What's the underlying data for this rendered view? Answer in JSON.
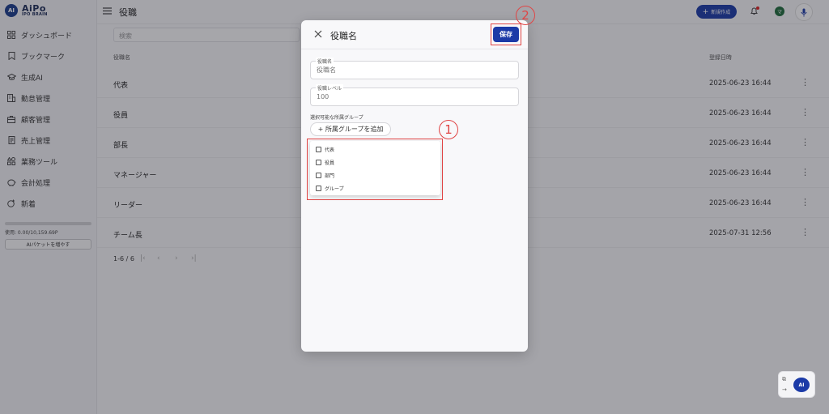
{
  "app": {
    "logo_badge": "AI",
    "logo_main": "AiPo",
    "logo_sub": "IPO BRAIN"
  },
  "sidebar": {
    "items": [
      {
        "label": "ダッシュボード",
        "icon": "grid-icon"
      },
      {
        "label": "ブックマーク",
        "icon": "bookmark-icon"
      },
      {
        "label": "生成AI",
        "icon": "graduation-cap-icon"
      },
      {
        "label": "勤怠管理",
        "icon": "building-icon"
      },
      {
        "label": "顧客管理",
        "icon": "briefcase-icon"
      },
      {
        "label": "売上管理",
        "icon": "receipt-icon"
      },
      {
        "label": "業務ツール",
        "icon": "shapes-icon"
      },
      {
        "label": "会計処理",
        "icon": "piggy-bank-icon"
      },
      {
        "label": "新着",
        "icon": "new-badge-icon"
      }
    ],
    "usage_text": "使用: 0.00/10,159.69P",
    "usage_fraction": 0.0,
    "ai_packet_button": "AIパケットを増やす"
  },
  "topbar": {
    "page_title": "役職",
    "new_button": "新規作成",
    "avatar_initial": "マ"
  },
  "table": {
    "search_placeholder": "検索",
    "col_name": "役職名",
    "col_date": "登録日時",
    "rows": [
      {
        "name": "代表",
        "date": "2025-06-23 16:44"
      },
      {
        "name": "役員",
        "date": "2025-06-23 16:44"
      },
      {
        "name": "部長",
        "date": "2025-06-23 16:44"
      },
      {
        "name": "マネージャー",
        "date": "2025-06-23 16:44"
      },
      {
        "name": "リーダー",
        "date": "2025-06-23 16:44"
      },
      {
        "name": "チーム長",
        "date": "2025-07-31 12:56"
      }
    ],
    "pager_text": "1-6 / 6"
  },
  "modal": {
    "title": "役職名",
    "save_label": "保存",
    "name_field_label": "役職名",
    "name_field_placeholder": "役職名",
    "level_field_label": "役職レベル",
    "level_field_placeholder": "100",
    "group_section_label": "選択可能な所属グループ",
    "add_group_button": "+ 所属グループを追加",
    "group_options": [
      "代表",
      "役員",
      "部門",
      "グループ"
    ]
  },
  "annotations": {
    "marker_1": "1",
    "marker_2": "2",
    "color": "#e04545"
  },
  "fab": {
    "ai_label": "AI"
  },
  "colors": {
    "primary": "#1b3aa7",
    "annotation": "#e04545"
  }
}
